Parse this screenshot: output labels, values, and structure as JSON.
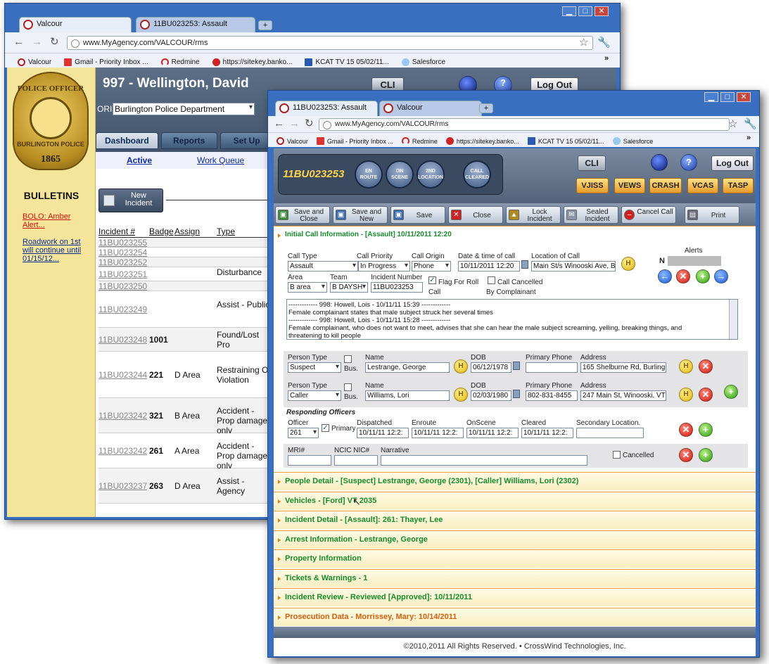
{
  "colors": {
    "accent_green": "#178a2c",
    "accent_orange": "#e07a10",
    "link_blue": "#0a2a99",
    "chrome_blue": "#3a6fbf"
  },
  "back": {
    "tabs": [
      "Valcour",
      "11BU023253: Assault"
    ],
    "url": "www.MyAgency.com/VALCOUR/rms",
    "bookmarks": [
      "Valcour",
      "Gmail - Priority Inbox ...",
      "Redmine",
      "https://sitekey.banko...",
      "KCAT TV 15 05/02/11...",
      "Salesforce"
    ],
    "user_title": "997 - Wellington, David",
    "ori_label": "ORI",
    "ori_value": "Burlington Police Department",
    "badge": {
      "top": "POLICE OFFICER",
      "mid": "BURLINGTON POLICE",
      "year": "1865"
    },
    "cli": "CLI",
    "logout": "Log Out",
    "nav_tabs": [
      "Dashboard",
      "Reports",
      "Set Up"
    ],
    "subnav": [
      "Active",
      "Work Queue"
    ],
    "new_incident": [
      "New",
      "Incident"
    ],
    "bulletins_title": "BULLETINS",
    "bulletins": [
      "BOLO: Amber Alert...",
      "Roadwork on 1st will continue until 01/15/12..."
    ],
    "table_headers": [
      "Incident #",
      "Badge",
      "Assign",
      "Type"
    ],
    "rows": [
      {
        "id": "11BU023255",
        "badge": "",
        "assign": "",
        "type": ""
      },
      {
        "id": "11BU023254",
        "badge": "",
        "assign": "",
        "type": ""
      },
      {
        "id": "11BU023252",
        "badge": "",
        "assign": "",
        "type": ""
      },
      {
        "id": "11BU023251",
        "badge": "",
        "assign": "",
        "type": "Disturbance"
      },
      {
        "id": "11BU023250",
        "badge": "",
        "assign": "",
        "type": ""
      },
      {
        "id": "11BU023249",
        "badge": "",
        "assign": "",
        "type": "Assist - Public"
      },
      {
        "id": "11BU023248",
        "badge": "1001",
        "assign": "",
        "type": "Found/Lost Pro"
      },
      {
        "id": "11BU023244",
        "badge": "221",
        "assign": "D Area",
        "type": "Restraining Or Violation"
      },
      {
        "id": "11BU023242",
        "badge": "321",
        "assign": "B Area",
        "type": "Accident - Prop damage only"
      },
      {
        "id": "11BU023242",
        "badge": "261",
        "assign": "A Area",
        "type": "Accident - Prop damage only"
      },
      {
        "id": "11BU023237",
        "badge": "263",
        "assign": "D Area",
        "type": "Assist - Agency"
      }
    ]
  },
  "front": {
    "tabs": [
      "11BU023253: Assault",
      "Valcour"
    ],
    "url": "www.MyAgency.com/VALCOUR/rms",
    "bookmarks": [
      "Valcour",
      "Gmail - Priority Inbox ...",
      "Redmine",
      "https://sitekey.banko...",
      "KCAT TV 15 05/02/11...",
      "Salesforce"
    ],
    "incident_no": "11BU023253",
    "status_buttons": [
      "EN ROUTE",
      "ON SCENE",
      "2ND LOCATION",
      "CALL CLEARED"
    ],
    "cli": "CLI",
    "logout": "Log Out",
    "agency_buttons": [
      "VJISS",
      "VEWS",
      "CRASH",
      "VCAS",
      "TASP"
    ],
    "toolbar": [
      "Save and Close",
      "Save and New",
      "Save",
      "Close",
      "Lock Incident",
      "Sealed Incident",
      "Cancel Call",
      "Print"
    ],
    "initial_section": "Initial Call Information - [Assault] 10/11/2011 12:20",
    "call": {
      "type_label": "Call Type",
      "type": "Assault",
      "priority_label": "Call Priority",
      "priority": "In Progress",
      "origin_label": "Call Origin",
      "origin": "Phone",
      "dt_label": "Date & time of call",
      "dt": "10/11/2011 12:20",
      "loc_label": "Location of Call",
      "loc": "Main St/s Winooski Ave, B",
      "area_label": "Area",
      "area": "B area",
      "team_label": "Team",
      "team": "B DAYSH",
      "num_label": "Incident Number",
      "num": "11BU023253",
      "flag_label": "Flag For Roll Call",
      "cancelled_label": "Call Cancelled By Complainant",
      "alerts_label": "Alerts",
      "alerts_n": "N"
    },
    "narrative_lines": [
      "------------- 998: Howell, Lois - 10/11/11 15:39 -------------",
      "Female complainant states that male subject struck her several times",
      "------------- 998: Howell, Lois - 10/11/11 15:28 -------------",
      "Female complainant, who does not want to meet, advises that she can hear the male subject screaming, yelling, breaking things, and",
      "threatening to kill people"
    ],
    "person_labels": {
      "type": "Person Type",
      "bus": "Bus.",
      "name": "Name",
      "dob": "DOB",
      "phone": "Primary Phone",
      "addr": "Address"
    },
    "persons": [
      {
        "type": "Suspect",
        "name": "Lestrange, George",
        "dob": "06/12/1978",
        "phone": "",
        "addr": "165 Shelburne Rd, Burling"
      },
      {
        "type": "Caller",
        "name": "Williams, Lori",
        "dob": "02/03/1980",
        "phone": "802-831-8455",
        "addr": "247 Main St, Winooski, VT"
      }
    ],
    "responding_title": "Responding Officers",
    "officer_labels": {
      "officer": "Officer",
      "primary": "Primary",
      "dispatched": "Dispatched",
      "enroute": "Enroute",
      "onscene": "OnScene",
      "cleared": "Cleared",
      "secondary": "Secondary Location."
    },
    "officer": {
      "officer": "261",
      "dispatched": "10/11/11 12:2:",
      "enroute": "10/11/11 12:2:",
      "onscene": "10/11/11 12:2:",
      "cleared": "10/11/11 12:2:"
    },
    "misc_labels": {
      "mri": "MRI#",
      "ncic": "NCIC NIC#",
      "narrative": "Narrative",
      "cancelled": "Cancelled"
    },
    "sections": [
      "People Detail - [Suspect] Lestrange, George (2301), [Caller] Williams, Lori (2302)",
      "Vehicles - [Ford] VT 2035",
      "Incident Detail - [Assault]: 261: Thayer, Lee",
      "Arrest Information - Lestrange, George",
      "Property Information",
      "Tickets & Warnings - 1",
      "Incident Review - Reviewed [Approved]: 10/11/2011",
      "Prosecution Data - Morrissey, Mary: 10/14/2011"
    ],
    "footer": "©2010,2011 All Rights Reserved.  •  CrossWind Technologies, Inc."
  }
}
